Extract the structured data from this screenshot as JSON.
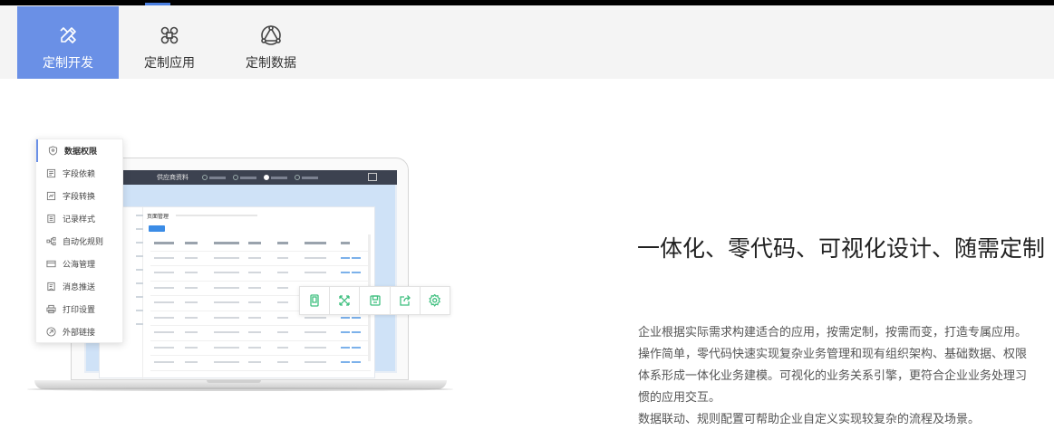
{
  "tabs": [
    {
      "label": "定制开发",
      "icon": "pencil-ruler-icon",
      "active": true
    },
    {
      "label": "定制应用",
      "icon": "command-icon",
      "active": false
    },
    {
      "label": "定制数据",
      "icon": "network-triangle-icon",
      "active": false
    }
  ],
  "menu": {
    "items": [
      {
        "label": "数据权限",
        "icon": "shield-icon",
        "active": true
      },
      {
        "label": "字段依赖",
        "icon": "field-dependency-icon"
      },
      {
        "label": "字段转换",
        "icon": "field-convert-icon"
      },
      {
        "label": "记录样式",
        "icon": "record-style-icon"
      },
      {
        "label": "自动化规则",
        "icon": "automation-icon"
      },
      {
        "label": "公海管理",
        "icon": "pool-icon"
      },
      {
        "label": "消息推送",
        "icon": "message-icon"
      },
      {
        "label": "打印设置",
        "icon": "printer-icon"
      },
      {
        "label": "外部链接",
        "icon": "link-icon"
      }
    ]
  },
  "laptop": {
    "app_title": "供应商资料",
    "panel_title": "页面管理"
  },
  "toolbar": {
    "buttons": [
      {
        "icon": "mobile-icon"
      },
      {
        "icon": "expand-icon"
      },
      {
        "icon": "save-icon"
      },
      {
        "icon": "share-icon"
      },
      {
        "icon": "gear-icon"
      }
    ]
  },
  "content": {
    "headline": "一体化、零代码、可视化设计、随需定制",
    "paragraph_1": "企业根据实际需求构建适合的应用，按需定制，按需而变，打造专属应用。",
    "paragraph_2": "操作简单，零代码快速实现复杂业务管理和现有组织架构、基础数据、权限体系形成一体化业务建模。可视化的业务关系引擎，更符合企业业务处理习惯的应用交互。",
    "paragraph_3": "数据联动、规则配置可帮助企业自定义实现较复杂的流程及场景。"
  },
  "colors": {
    "accent": "#6a90e6",
    "toolbar_icon": "#3fbf7f",
    "tabbar_bg": "#f4f4f4"
  }
}
